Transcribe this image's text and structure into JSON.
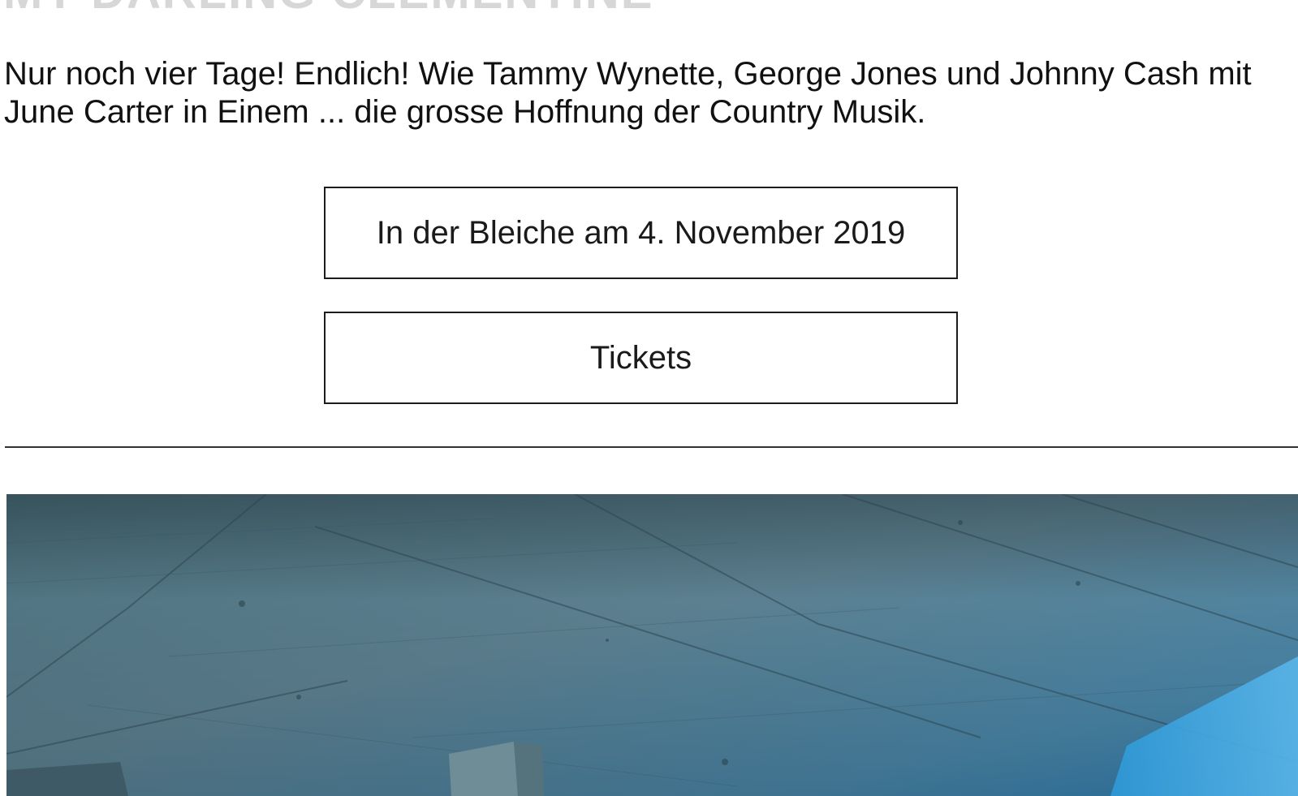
{
  "header": {
    "title": "MY DARLING CLEMENTINE"
  },
  "intro": {
    "text": "Nur noch vier Tage! Endlich! Wie Tammy Wynette, George Jones und Johnny Cash mit June Carter in Einem ... die grosse Hoffnung der Country Musik."
  },
  "event": {
    "date_label": "In der Bleiche am 4. November 2019",
    "tickets_label": "Tickets"
  },
  "photo": {
    "description_icon": "concrete-ceiling-photo"
  },
  "colors": {
    "heading": "#d7d7d7",
    "text": "#111111",
    "border": "#1c1c1c",
    "photo_base": "#2f5b6c",
    "photo_highlight": "#3f8fb8"
  }
}
